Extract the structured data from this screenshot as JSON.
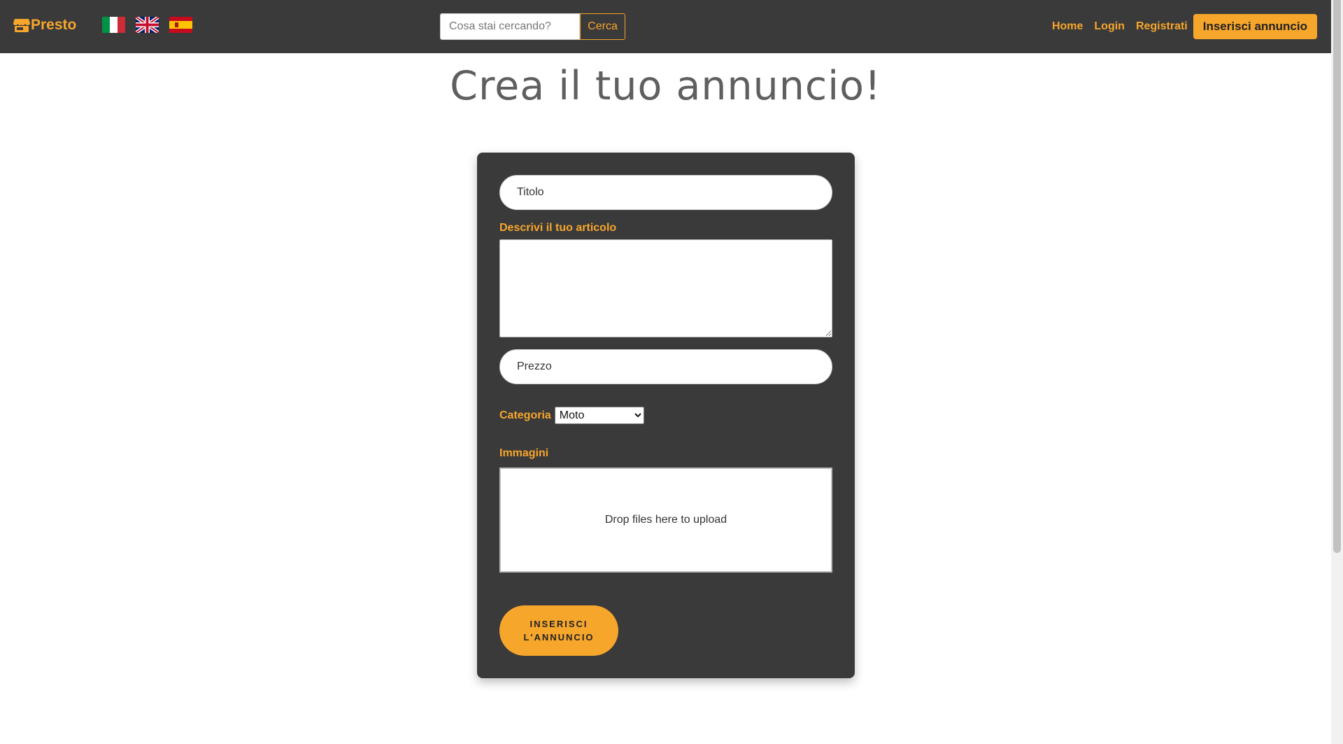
{
  "navbar": {
    "brand": "Presto",
    "brand_icon": "store-icon",
    "flags": [
      {
        "name": "italy-flag-icon",
        "lang": "it"
      },
      {
        "name": "uk-flag-icon",
        "lang": "en"
      },
      {
        "name": "spain-flag-icon",
        "lang": "es"
      }
    ],
    "search": {
      "placeholder": "Cosa stai cercando?",
      "value": "",
      "button_label": "Cerca"
    },
    "links": {
      "home": "Home",
      "login": "Login",
      "register": "Registrati",
      "cta": "Inserisci annuncio"
    }
  },
  "page": {
    "title": "Crea il tuo annuncio!"
  },
  "form": {
    "title_field": {
      "placeholder": "Titolo",
      "value": ""
    },
    "description_label": "Descrivi il tuo articolo",
    "description_value": "",
    "price_field": {
      "placeholder": "Prezzo",
      "value": ""
    },
    "category_label": "Categoria",
    "category_selected": "Moto",
    "images_label": "Immagini",
    "dropzone_text": "Drop files here to upload",
    "submit_label": "Inserisci l'annuncio"
  },
  "colors": {
    "accent": "#f7a62c",
    "navbar_bg": "#3a3a3a",
    "card_bg": "#3a3a3a",
    "title_text": "#5f5f5f"
  }
}
